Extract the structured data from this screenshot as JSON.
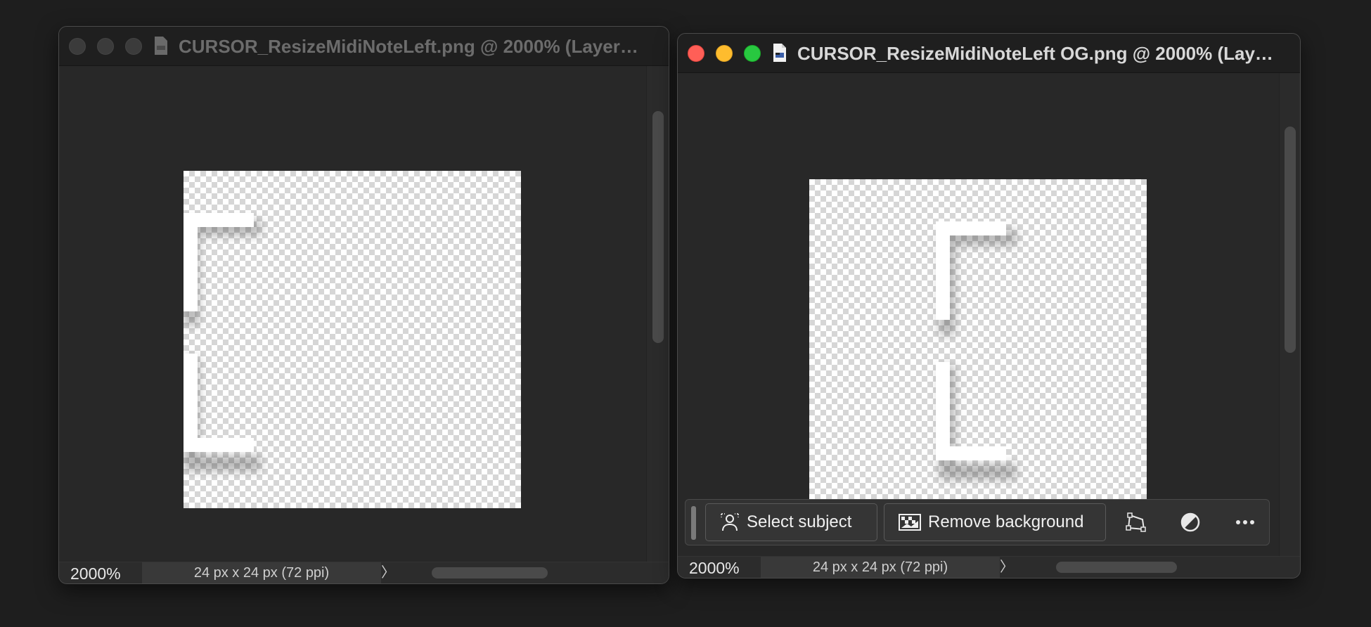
{
  "windows": [
    {
      "title": "CURSOR_ResizeMidiNoteLeft.png @ 2000% (Layer…",
      "focused": false,
      "zoom": "2000%",
      "doc_info": "24 px x 24 px (72 ppi)",
      "doc_info_arrow": "〉"
    },
    {
      "title": "CURSOR_ResizeMidiNoteLeft OG.png @ 2000% (Lay…",
      "focused": true,
      "zoom": "2000%",
      "doc_info": "24 px x 24 px (72 ppi)",
      "doc_info_arrow": "〉",
      "taskbar": {
        "select_subject": "Select subject",
        "remove_background": "Remove background",
        "icons": [
          "transform-icon",
          "adjustment-icon",
          "more-icon"
        ]
      }
    }
  ],
  "colors": {
    "close": "#ff5f57",
    "minimize": "#febc2e",
    "maximize": "#28c840"
  }
}
